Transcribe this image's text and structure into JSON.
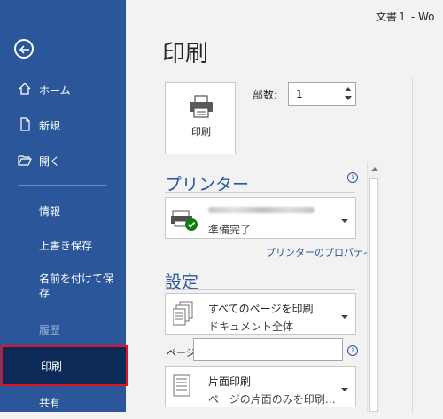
{
  "window": {
    "title": "文書１ - Wo"
  },
  "sidebar": {
    "home": "ホーム",
    "new": "新規",
    "open": "開く",
    "info": "情報",
    "save": "上書き保存",
    "save_as": "名前を付けて保存",
    "history": "履歴",
    "print": "印刷",
    "share": "共有"
  },
  "main": {
    "title": "印刷",
    "print_button": "印刷",
    "copies_label": "部数:",
    "copies_value": "1",
    "printer_section": "プリンター",
    "printer_status": "準備完了",
    "printer_properties_link": "プリンターのプロパティ",
    "settings_section": "設定",
    "setting1_main": "すべてのページを印刷",
    "setting1_sub": "ドキュメント全体",
    "pages_label": "ページ:",
    "setting2_main": "片面印刷",
    "setting2_sub": "ページの片面のみを印刷…"
  },
  "colors": {
    "sidebar": "#2b579a",
    "selected": "#0b2a57",
    "highlight_border": "#e81123",
    "status_ok": "#107c10"
  }
}
